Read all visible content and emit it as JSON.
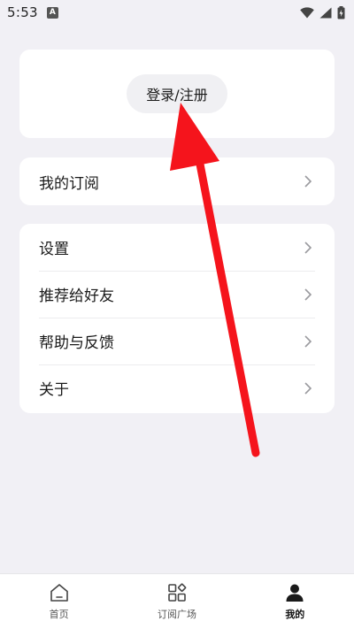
{
  "status_bar": {
    "time": "5:53",
    "notification_badge": "A",
    "icons": [
      "wifi-icon",
      "signal-icon",
      "battery-icon"
    ]
  },
  "login": {
    "button_label": "登录/注册"
  },
  "subscription": {
    "label": "我的订阅"
  },
  "settings_list": [
    {
      "label": "设置"
    },
    {
      "label": "推荐给好友"
    },
    {
      "label": "帮助与反馈"
    },
    {
      "label": "关于"
    }
  ],
  "bottom_nav": {
    "items": [
      {
        "label": "首页",
        "icon": "home-icon"
      },
      {
        "label": "订阅广场",
        "icon": "grid-icon"
      },
      {
        "label": "我的",
        "icon": "profile-icon",
        "active": true
      }
    ]
  },
  "colors": {
    "background": "#f1f0f5",
    "card": "#ffffff",
    "annotation_arrow": "#f5141c"
  }
}
